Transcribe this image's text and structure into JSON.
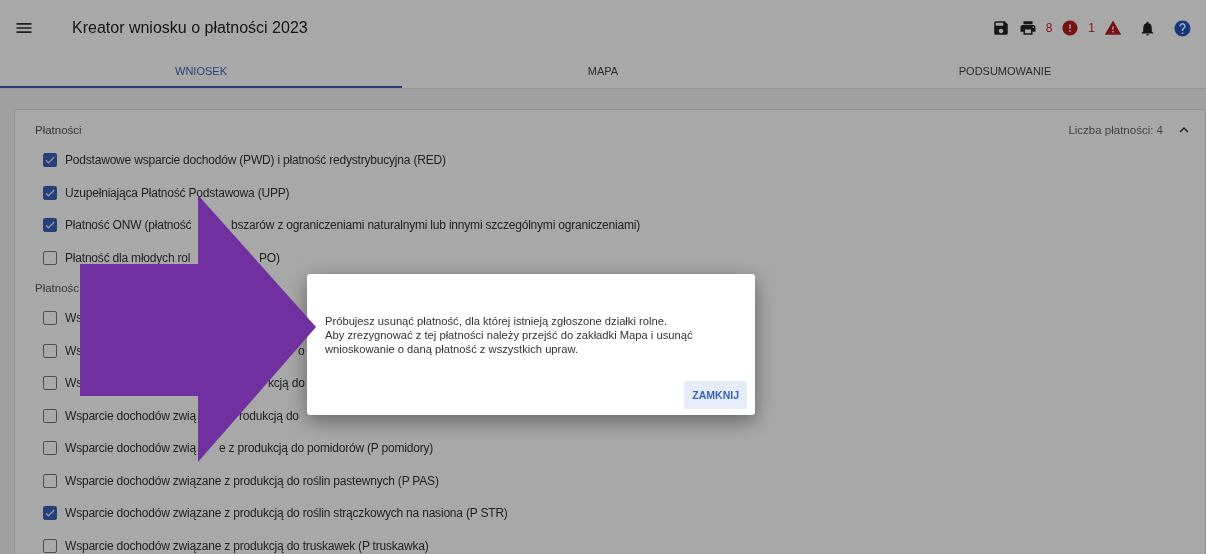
{
  "header": {
    "title": "Kreator wniosku o płatności 2023",
    "error_count": "8",
    "warning_count": "1"
  },
  "tabs": [
    {
      "label": "WNIOSEK",
      "selected": true
    },
    {
      "label": "MAPA",
      "selected": false
    },
    {
      "label": "PODSUMOWANIE",
      "selected": false
    }
  ],
  "sections": [
    {
      "title": "Płatności",
      "summary": "Liczba płatności: 4",
      "expanded": true,
      "items": [
        {
          "label_parts": [
            "Podstawowe wsparcie dochodów (PWD) i płatność redystrybucyjna (RED)"
          ],
          "checked": true
        },
        {
          "label_parts": [
            "Uzupełniająca Płatność Podstawowa (UPP)"
          ],
          "checked": true
        },
        {
          "label_parts": [
            "Płatność ONW (płatność",
            "bszarów z ograniczeniami naturalnymi lub innymi szczególnymi ograniczeniami)"
          ],
          "checked": true
        },
        {
          "label_parts": [
            "Płatność dla młodych rol",
            "PO)"
          ],
          "checked": false
        }
      ]
    },
    {
      "title": "Płatnośc",
      "items": [
        {
          "label_parts": [
            "Ws"
          ],
          "checked": false
        },
        {
          "label_parts": [
            "Ws",
            "o"
          ],
          "checked": false
        },
        {
          "label_parts": [
            "Ws",
            "kcją do"
          ],
          "checked": false
        },
        {
          "label_parts": [
            "Wsparcie dochodów zwią",
            "rodukcją do"
          ],
          "checked": false
        },
        {
          "label_parts": [
            "Wsparcie dochodów zwią",
            "e z produkcją do pomidorów (P pomidory)"
          ],
          "checked": false
        },
        {
          "label_parts": [
            "Wsparcie dochodów związane z produkcją do roślin pastewnych (P PAS)"
          ],
          "checked": false
        },
        {
          "label_parts": [
            "Wsparcie dochodów związane z produkcją do roślin strączkowych na nasiona (P STR)"
          ],
          "checked": true
        },
        {
          "label_parts": [
            "Wsparcie dochodów związane z produkcją do truskawek (P truskawka)"
          ],
          "checked": false
        }
      ]
    }
  ],
  "dialog": {
    "message_lines": [
      "Próbujesz usunąć płatność, dla której istnieją zgłoszone działki rolne.",
      "Aby zrezygnować z tej płatności należy przejść do zakładki Mapa i usunąć",
      "wnioskowanie o daną płatność z wszystkich upraw."
    ],
    "button": "ZAMKNIJ"
  }
}
